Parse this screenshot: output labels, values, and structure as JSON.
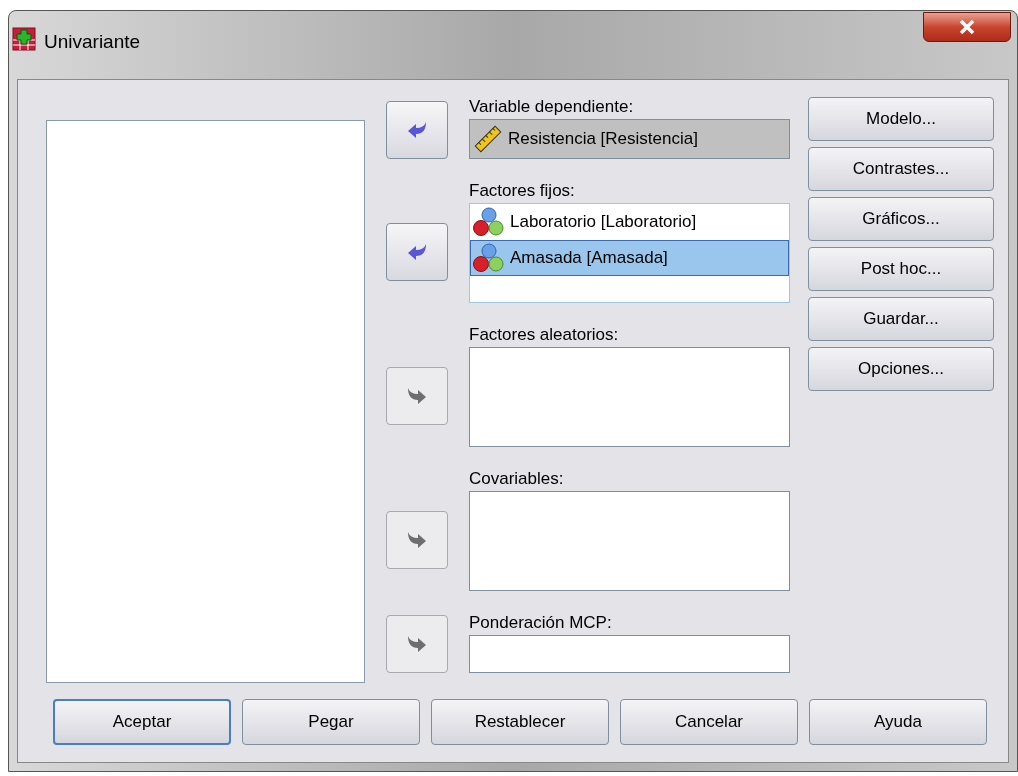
{
  "window": {
    "title": "Univariante"
  },
  "targets": [
    {
      "label": "Variable dependiente:",
      "kind": "single",
      "arrow": {
        "kind": "left",
        "disabled": false
      },
      "items": [
        {
          "name": "Resistencia [Resistencia]",
          "kind": "scale",
          "selected": false
        }
      ]
    },
    {
      "label": "Factores fijos:",
      "kind": "list",
      "arrow": {
        "kind": "left",
        "disabled": false
      },
      "items": [
        {
          "name": "Laboratorio [Laboratorio]",
          "kind": "nominal",
          "selected": false
        },
        {
          "name": "Amasada [Amasada]",
          "kind": "nominal",
          "selected": true
        }
      ]
    },
    {
      "label": "Factores aleatorios:",
      "kind": "list",
      "arrow": {
        "kind": "right",
        "disabled": true
      }
    },
    {
      "label": "Covariables:",
      "kind": "list",
      "arrow": {
        "kind": "right",
        "disabled": true
      }
    },
    {
      "label": "Ponderación MCP:",
      "kind": "field",
      "arrow": {
        "kind": "right",
        "disabled": true
      }
    }
  ],
  "side_buttons": [
    "Modelo...",
    "Contrastes...",
    "Gráficos...",
    "Post hoc...",
    "Guardar...",
    "Opciones..."
  ],
  "buttons": [
    {
      "label": "Aceptar",
      "default": true
    },
    {
      "label": "Pegar",
      "default": false
    },
    {
      "label": "Restablecer",
      "default": false
    },
    {
      "label": "Cancelar",
      "default": false
    },
    {
      "label": "Ayuda",
      "default": false
    }
  ]
}
